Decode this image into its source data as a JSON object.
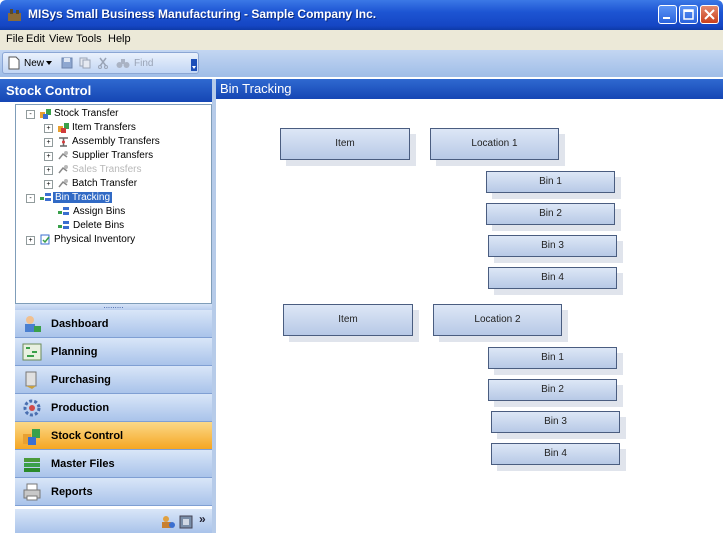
{
  "window": {
    "title": "MISys Small Business Manufacturing - Sample Company Inc."
  },
  "menu": [
    "File",
    "Edit",
    "View",
    "Tools",
    "Help"
  ],
  "toolbar": {
    "new_label": "New",
    "find_label": "Find"
  },
  "left_panel": {
    "title": "Stock Control",
    "tree": [
      {
        "label": "Stock Transfer",
        "icon": "stock-transfer-icon",
        "expander": "-"
      },
      {
        "label": "Item Transfers",
        "icon": "item-transfers-icon",
        "expander": "+"
      },
      {
        "label": "Assembly Transfers",
        "icon": "assembly-transfers-icon",
        "expander": "+"
      },
      {
        "label": "Supplier Transfers",
        "icon": "supplier-transfers-icon",
        "expander": "+"
      },
      {
        "label": "Sales Transfers",
        "icon": "sales-transfers-icon",
        "expander": "+"
      },
      {
        "label": "Batch Transfer",
        "icon": "batch-transfer-icon",
        "expander": "+"
      },
      {
        "label": "Bin Tracking",
        "icon": "bin-tracking-icon",
        "expander": "-"
      },
      {
        "label": "Assign Bins",
        "icon": "assign-bins-icon",
        "expander": ""
      },
      {
        "label": "Delete Bins",
        "icon": "delete-bins-icon",
        "expander": ""
      },
      {
        "label": "Physical Inventory",
        "icon": "physical-inventory-icon",
        "expander": "+"
      }
    ],
    "nav": [
      {
        "label": "Dashboard",
        "icon": "dashboard-icon"
      },
      {
        "label": "Planning",
        "icon": "planning-icon"
      },
      {
        "label": "Purchasing",
        "icon": "purchasing-icon"
      },
      {
        "label": "Production",
        "icon": "production-icon"
      },
      {
        "label": "Stock Control",
        "icon": "stock-control-icon"
      },
      {
        "label": "Master Files",
        "icon": "master-files-icon"
      },
      {
        "label": "Reports",
        "icon": "reports-icon"
      }
    ],
    "footer_chevron": "»"
  },
  "right_panel": {
    "title": "Bin Tracking",
    "groups": [
      {
        "item": "Item",
        "location": "Location 1",
        "bins": [
          "Bin 1",
          "Bin 2",
          "Bin 3",
          "Bin 4"
        ]
      },
      {
        "item": "Item",
        "location": "Location 2",
        "bins": [
          "Bin 1",
          "Bin 2",
          "Bin 3",
          "Bin 4"
        ]
      }
    ]
  }
}
